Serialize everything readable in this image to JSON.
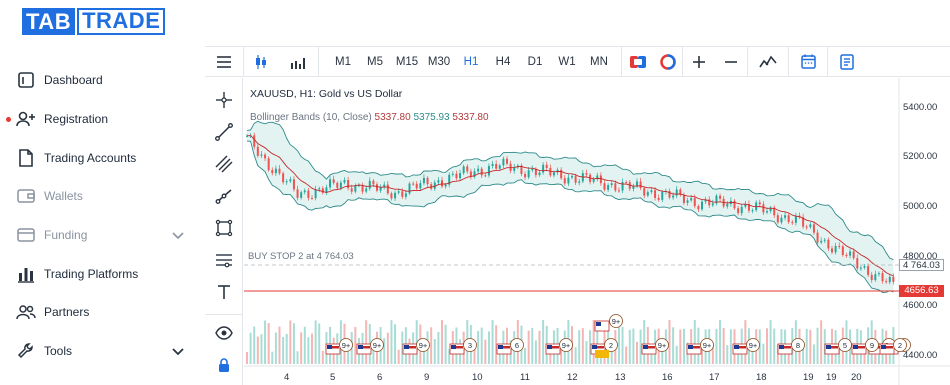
{
  "brand": {
    "left": "TAB",
    "right": "TRADE",
    "color": "#1f6fe0"
  },
  "sidebar": {
    "items": [
      {
        "label": "Dashboard",
        "icon": "dashboard-icon",
        "disabled": false
      },
      {
        "label": "Registration",
        "icon": "add-user-icon",
        "disabled": false,
        "alert": true
      },
      {
        "label": "Trading Accounts",
        "icon": "document-icon",
        "disabled": false
      },
      {
        "label": "Wallets",
        "icon": "wallet-icon",
        "disabled": true
      },
      {
        "label": "Funding",
        "icon": "card-icon",
        "disabled": true,
        "expandable": true
      },
      {
        "label": "Trading Platforms",
        "icon": "bar-chart-icon",
        "disabled": false
      },
      {
        "label": "Partners",
        "icon": "users-icon",
        "disabled": false
      },
      {
        "label": "Tools",
        "icon": "wrench-icon",
        "disabled": false,
        "expandable": true
      }
    ]
  },
  "toolbar": {
    "timeframes": [
      "M1",
      "M5",
      "M15",
      "M30",
      "H1",
      "H4",
      "D1",
      "W1",
      "MN"
    ],
    "active_timeframe": "H1"
  },
  "chart": {
    "title": "XAUUSD, H1: Gold vs US Dollar",
    "indicator": {
      "name": "Bollinger Bands (10, Close)",
      "upper": "5337.80",
      "middle": "5375.93",
      "lower": "5337.80"
    },
    "order_label": "BUY STOP 2 at 4 764.03",
    "order_price_tag": "4 764.03",
    "current_price_tag": "4656.63",
    "price_axis": [
      "5400.00",
      "5200.00",
      "5000.00",
      "4800.00",
      "4600.00",
      "4400.00"
    ],
    "date_axis": [
      "4",
      "5",
      "6",
      "9",
      "10",
      "11",
      "12",
      "13",
      "16",
      "17",
      "18",
      "19",
      "19",
      "20"
    ],
    "event_badges": [
      "9+",
      "9+",
      "9+",
      "3",
      "6",
      "9+",
      "2",
      "9+",
      "9+",
      "9+",
      "8",
      "5",
      "9+",
      "9",
      "9",
      "2"
    ],
    "top_badge": "9+",
    "colors": {
      "candle_up": "#26a69a",
      "candle_down": "#ef5350",
      "band": "#2e8a8a",
      "middle": "#c62828",
      "current_price": "#e53935"
    }
  },
  "chart_data": {
    "type": "line",
    "title": "XAUUSD, H1: Gold vs US Dollar",
    "x": [
      "4",
      "5",
      "6",
      "9",
      "10",
      "11",
      "12",
      "13",
      "16",
      "17",
      "18",
      "19",
      "19",
      "20"
    ],
    "series": [
      {
        "name": "Bollinger Bands (10, Close)",
        "values": [
          5320,
          5070,
          5120,
          5080,
          5140,
          5200,
          5170,
          5130,
          5090,
          5040,
          5020,
          4960,
          4800,
          4656
        ]
      }
    ],
    "ylim": [
      4400,
      5450
    ],
    "grid": false
  }
}
